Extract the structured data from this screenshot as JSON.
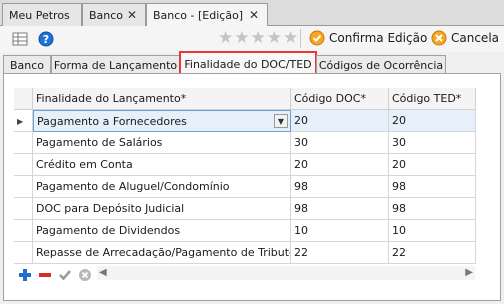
{
  "doc_tabs": [
    {
      "label": "Meu Petros"
    },
    {
      "label": "Banco",
      "close": "✕"
    },
    {
      "label": "Banco - [Edição]",
      "close": "✕"
    }
  ],
  "toolbar": {
    "rating_stars": "★★★★★",
    "confirm_label": "Confirma Edição",
    "cancel_label": "Cancela",
    "accent": "#f0a020"
  },
  "sub_tabs": [
    {
      "label": "Banco"
    },
    {
      "label": "Forma de Lançamento"
    },
    {
      "label": "Finalidade do DOC/TED",
      "active": true
    },
    {
      "label": "Códigos de Ocorrência"
    }
  ],
  "grid": {
    "headers": [
      "Finalidade do Lançamento*",
      "Código DOC*",
      "Código TED*"
    ],
    "rows": [
      {
        "finalidade": "Pagamento a Fornecedores",
        "doc": "20",
        "ted": "20"
      },
      {
        "finalidade": "Pagamento de Salários",
        "doc": "30",
        "ted": "30"
      },
      {
        "finalidade": "Crédito em Conta",
        "doc": "20",
        "ted": "20"
      },
      {
        "finalidade": "Pagamento de Aluguel/Condomínio",
        "doc": "98",
        "ted": "98"
      },
      {
        "finalidade": "DOC para Depósito Judicial",
        "doc": "98",
        "ted": "98"
      },
      {
        "finalidade": "Pagamento de Dividendos",
        "doc": "10",
        "ted": "10"
      },
      {
        "finalidade": "Repasse de Arrecadação/Pagamento de Tributos",
        "doc": "22",
        "ted": "22"
      }
    ],
    "row_pointer": "▶",
    "dropdown_arrow": "▼"
  },
  "bottom": {
    "add": "+",
    "remove": "−",
    "scroll_left": "◀",
    "scroll_right": "▶"
  }
}
